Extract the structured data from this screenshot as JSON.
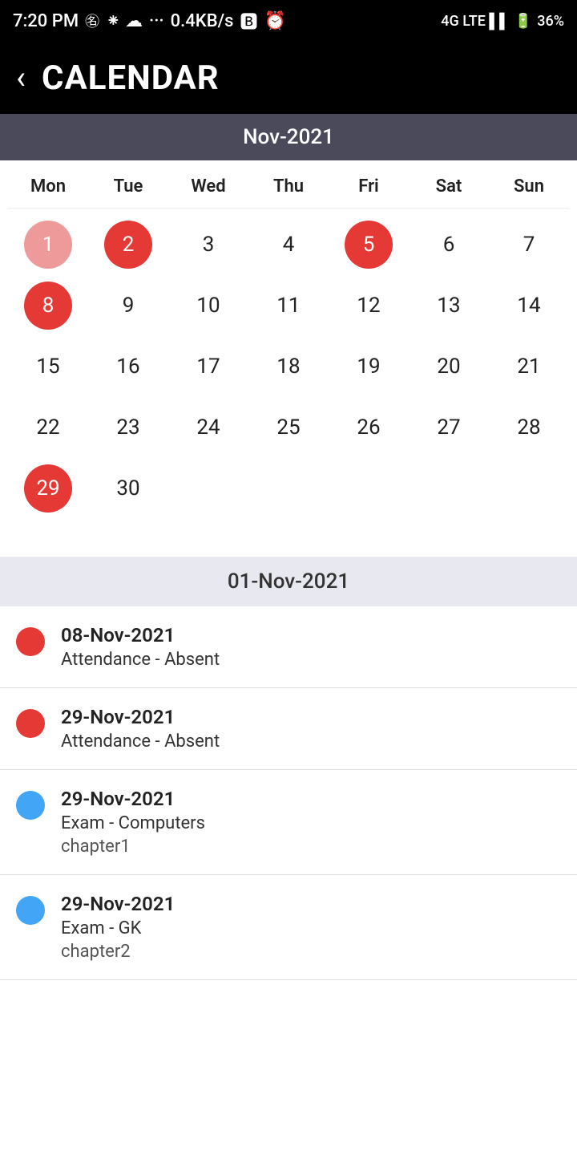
{
  "statusBar": {
    "time": "7:20 PM",
    "speed": "0.4KB/s",
    "battery": "36%"
  },
  "header": {
    "title": "CALENDAR",
    "backLabel": "‹"
  },
  "calendar": {
    "monthLabel": "Nov-2021",
    "weekdays": [
      "Mon",
      "Tue",
      "Wed",
      "Thu",
      "Fri",
      "Sat",
      "Sun"
    ],
    "days": [
      {
        "num": "1",
        "style": "red-light"
      },
      {
        "num": "2",
        "style": "red-circle"
      },
      {
        "num": "3",
        "style": "normal"
      },
      {
        "num": "4",
        "style": "normal"
      },
      {
        "num": "5",
        "style": "red-circle"
      },
      {
        "num": "6",
        "style": "normal"
      },
      {
        "num": "7",
        "style": "normal"
      },
      {
        "num": "8",
        "style": "red-circle"
      },
      {
        "num": "9",
        "style": "normal"
      },
      {
        "num": "10",
        "style": "normal"
      },
      {
        "num": "11",
        "style": "normal"
      },
      {
        "num": "12",
        "style": "normal"
      },
      {
        "num": "13",
        "style": "normal"
      },
      {
        "num": "14",
        "style": "normal"
      },
      {
        "num": "15",
        "style": "normal"
      },
      {
        "num": "16",
        "style": "normal"
      },
      {
        "num": "17",
        "style": "normal"
      },
      {
        "num": "18",
        "style": "normal"
      },
      {
        "num": "19",
        "style": "normal"
      },
      {
        "num": "20",
        "style": "normal"
      },
      {
        "num": "21",
        "style": "normal"
      },
      {
        "num": "22",
        "style": "normal"
      },
      {
        "num": "23",
        "style": "normal"
      },
      {
        "num": "24",
        "style": "normal"
      },
      {
        "num": "25",
        "style": "normal"
      },
      {
        "num": "26",
        "style": "normal"
      },
      {
        "num": "27",
        "style": "normal"
      },
      {
        "num": "28",
        "style": "normal"
      },
      {
        "num": "29",
        "style": "red-circle"
      },
      {
        "num": "30",
        "style": "normal"
      }
    ]
  },
  "eventsDateHeader": "01-Nov-2021",
  "events": [
    {
      "dotColor": "red",
      "date": "08-Nov-2021",
      "description": "Attendance - Absent",
      "subtext": ""
    },
    {
      "dotColor": "red",
      "date": "29-Nov-2021",
      "description": "Attendance - Absent",
      "subtext": ""
    },
    {
      "dotColor": "blue",
      "date": "29-Nov-2021",
      "description": "Exam - Computers",
      "subtext": "chapter1"
    },
    {
      "dotColor": "blue",
      "date": "29-Nov-2021",
      "description": "Exam - GK",
      "subtext": "chapter2"
    }
  ]
}
